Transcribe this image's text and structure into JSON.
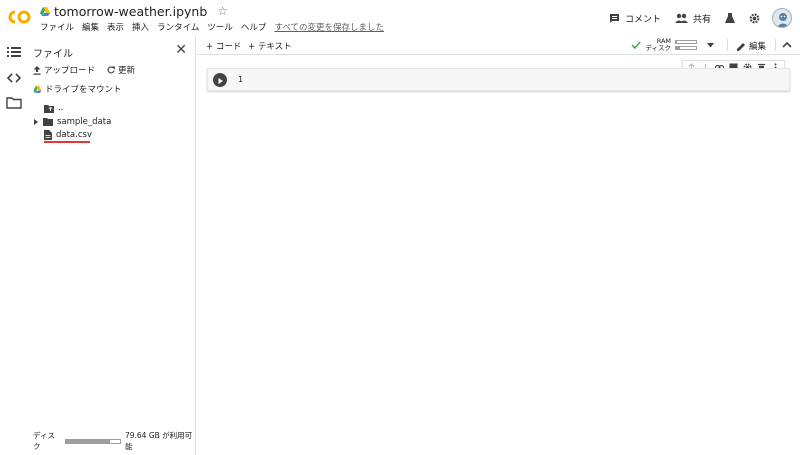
{
  "app": {
    "title": "tomorrow-weather.ipynb",
    "logo_text": "CO",
    "brand_colors": {
      "orange": "#F9AB00",
      "accent_red": "#E53935",
      "check_green": "#34A853"
    }
  },
  "menu": {
    "items": [
      "ファイル",
      "編集",
      "表示",
      "挿入",
      "ランタイム",
      "ツール",
      "ヘルプ"
    ],
    "unsaved_status": "すべての変更を保存しました"
  },
  "top_actions": {
    "comment_label": "コメント",
    "share_label": "共有"
  },
  "files_panel": {
    "title": "ファイル",
    "upload_label": "アップロード",
    "refresh_label": "更新",
    "mount_label": "ドライブをマウント",
    "tree": [
      {
        "name": "..",
        "type": "folder-up"
      },
      {
        "name": "sample_data",
        "type": "folder"
      },
      {
        "name": "data.csv",
        "type": "file"
      }
    ],
    "disk": {
      "label": "ディスク",
      "free_text": "79.64 GB が利用可能",
      "used_fraction": 0.82
    }
  },
  "toolbar": {
    "add_code": "+ コード",
    "add_text": "+ テキスト",
    "ram_label": "RAM",
    "disk_label": "ディスク",
    "ram_fraction": 0.05,
    "disk_fraction": 0.2,
    "edit_label": "編集"
  },
  "cell": {
    "line_number": "1"
  }
}
